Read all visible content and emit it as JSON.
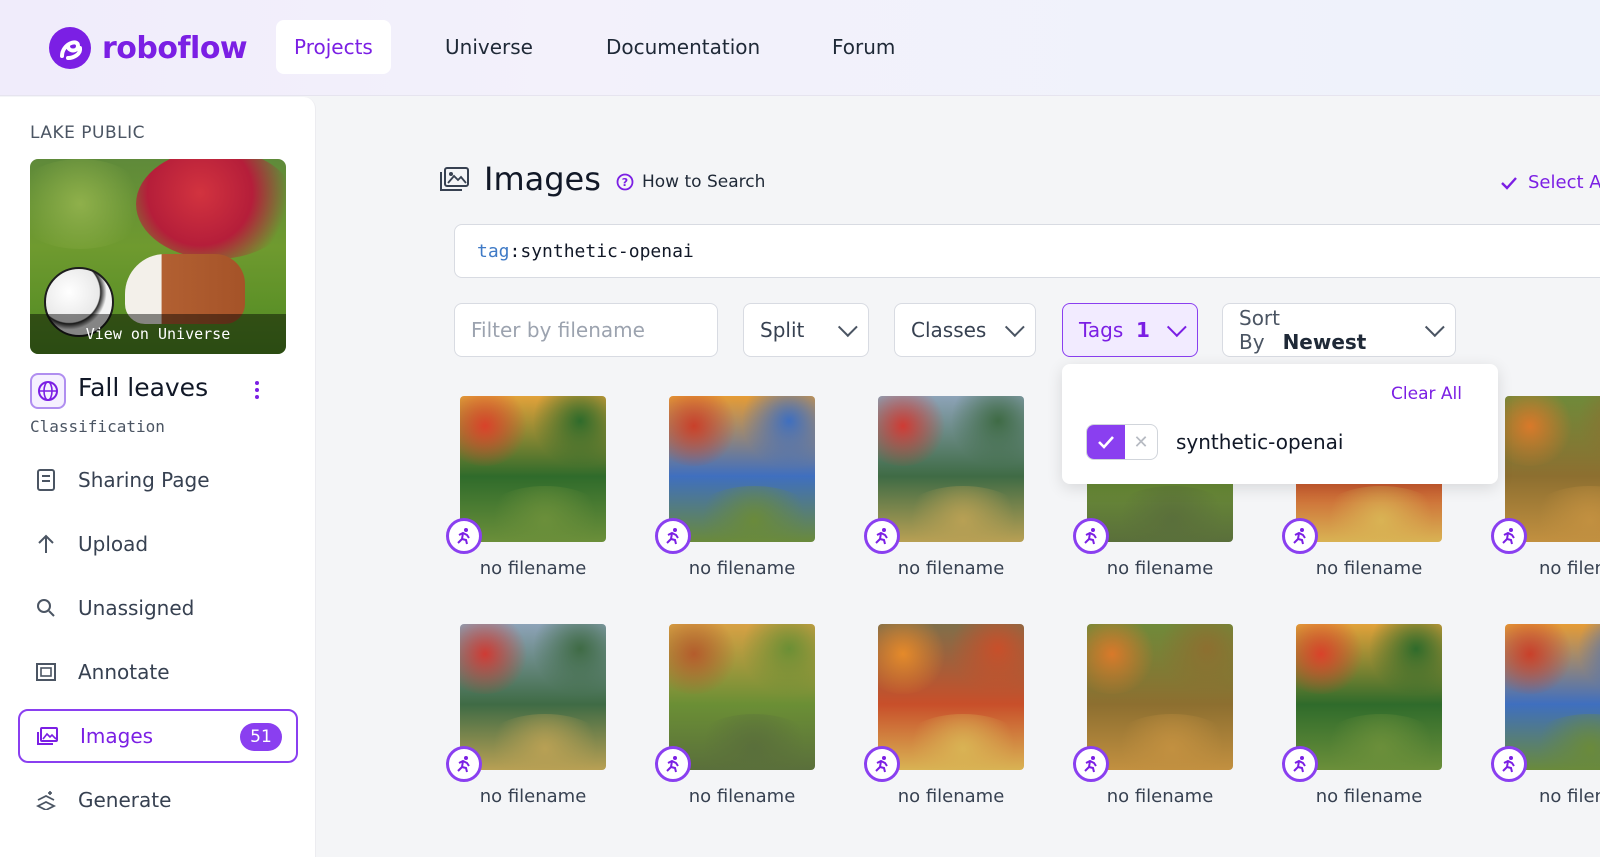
{
  "brand": {
    "name": "roboflow",
    "accent": "#7b1fe4"
  },
  "nav": [
    {
      "label": "Projects",
      "active": true
    },
    {
      "label": "Universe"
    },
    {
      "label": "Documentation"
    },
    {
      "label": "Forum"
    }
  ],
  "sidebar": {
    "workspace": "LAKE PUBLIC",
    "thumbnail_caption": "View on Universe",
    "project_name": "Fall leaves",
    "project_type": "Classification",
    "items": [
      {
        "label": "Sharing Page",
        "icon": "document-icon"
      },
      {
        "label": "Upload",
        "icon": "upload-arrow-icon"
      },
      {
        "label": "Unassigned",
        "icon": "search-icon"
      },
      {
        "label": "Annotate",
        "icon": "annotate-icon"
      },
      {
        "label": "Images",
        "icon": "images-icon",
        "active": true,
        "badge": "51"
      },
      {
        "label": "Generate",
        "icon": "generate-icon"
      }
    ]
  },
  "main": {
    "title": "Images",
    "how_to_search": "How to Search",
    "select_all": "Select A",
    "search": {
      "key": "tag",
      "sep": ":",
      "value": "synthetic-openai"
    },
    "filters": {
      "filename_placeholder": "Filter by filename",
      "split": "Split",
      "classes": "Classes",
      "tags": "Tags",
      "tags_count": "1",
      "sort_label": "Sort By",
      "sort_value": "Newest"
    },
    "tags_dropdown": {
      "clear_all": "Clear All",
      "tag": "synthetic-openai",
      "checked": true
    },
    "tiles_row1": [
      "no filename",
      "no filename",
      "no filename",
      "no filename",
      "no filename",
      "no filena"
    ],
    "tiles_row2": [
      "no filename",
      "no filename",
      "no filename",
      "no filename",
      "no filename",
      "no filena"
    ]
  }
}
